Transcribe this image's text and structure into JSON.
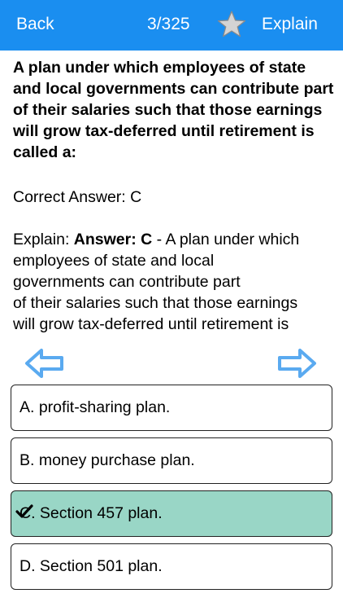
{
  "navbar": {
    "back_label": "Back",
    "counter": "3/325",
    "star_icon": "star-icon",
    "explain_label": "Explain",
    "bg_color": "#1a8ef0"
  },
  "question": {
    "text": "A plan under which employees of state and local governments can contribute part of their salaries such that those earnings will grow tax-deferred until retirement is called a:"
  },
  "correct_answer": {
    "text": "Correct Answer: C"
  },
  "explanation": {
    "prefix": "Explain: ",
    "answer_label": "Answer: C",
    "line1": " - A plan under which",
    "line2": "employees of state and local",
    "line3": "governments can contribute part",
    "line4": "of their salaries such that those earnings",
    "line5": "will grow tax-deferred until retirement is"
  },
  "navigation": {
    "prev_icon": "arrow-left-icon",
    "next_icon": "arrow-right-icon",
    "arrow_color": "#5aaaf0"
  },
  "options": [
    {
      "label": "A. profit-sharing plan.",
      "selected": false
    },
    {
      "label": "B. money purchase plan.",
      "selected": false
    },
    {
      "label": "C. Section 457 plan.",
      "selected": true,
      "highlight_color": "#99d6c6"
    },
    {
      "label": "D. Section 501 plan.",
      "selected": false
    }
  ]
}
